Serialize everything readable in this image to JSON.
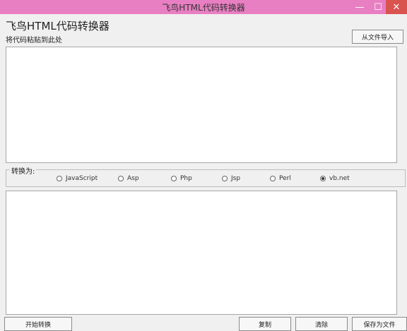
{
  "window": {
    "title": "飞鸟HTML代码转换器",
    "min_label": "—",
    "max_label": "☐",
    "close_label": "✕"
  },
  "header": {
    "app_name": "飞鸟HTML代码转换器",
    "hint": "将代码粘贴到此处",
    "import_label": "从文件导入"
  },
  "convert": {
    "group_label": "转换为:",
    "options": [
      {
        "label": "JavaScript",
        "checked": false
      },
      {
        "label": "Asp",
        "checked": false
      },
      {
        "label": "Php",
        "checked": false
      },
      {
        "label": "Jsp",
        "checked": false
      },
      {
        "label": "Perl",
        "checked": false
      },
      {
        "label": "vb.net",
        "checked": true
      }
    ]
  },
  "footer": {
    "buttons": [
      "开始转换",
      "复制",
      "清除",
      "保存为文件"
    ]
  }
}
